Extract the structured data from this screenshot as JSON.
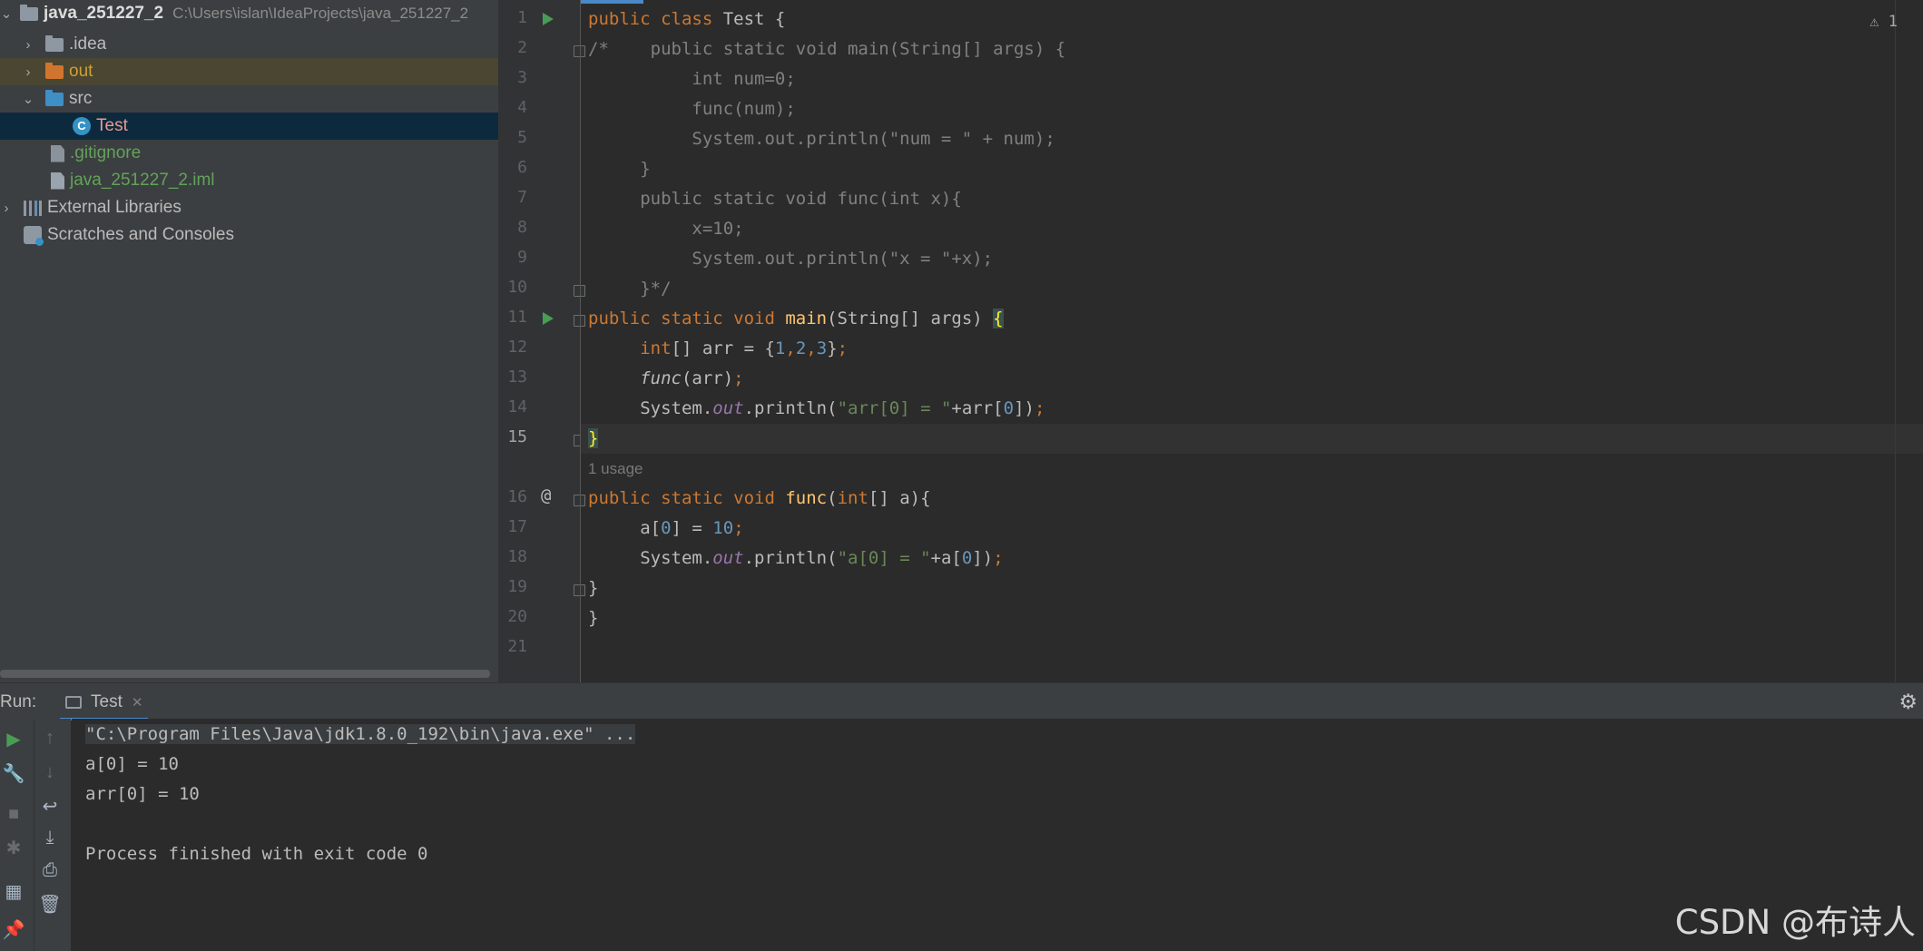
{
  "project_tree": {
    "root_name": "java_251227_2",
    "root_path": "C:\\Users\\islan\\IdeaProjects\\java_251227_2",
    "items": [
      {
        "label": ".idea"
      },
      {
        "label": "out"
      },
      {
        "label": "src"
      },
      {
        "label": "Test"
      },
      {
        "label": ".gitignore"
      },
      {
        "label": "java_251227_2.iml"
      },
      {
        "label": "External Libraries"
      },
      {
        "label": "Scratches and Consoles"
      }
    ]
  },
  "editor": {
    "warning_count": "1",
    "usage_hint": "1 usage",
    "line_numbers": [
      "1",
      "2",
      "3",
      "4",
      "5",
      "6",
      "7",
      "8",
      "9",
      "10",
      "11",
      "12",
      "13",
      "14",
      "15",
      "16",
      "17",
      "18",
      "19",
      "20",
      "21"
    ],
    "current_line": "15"
  },
  "run_panel": {
    "title": "Run:",
    "tab_label": "Test",
    "console_lines": [
      "\"C:\\Program Files\\Java\\jdk1.8.0_192\\bin\\java.exe\" ...",
      "a[0] = 10",
      "arr[0] = 10",
      "",
      "Process finished with exit code 0"
    ]
  },
  "watermark": "CSDN @布诗人",
  "colors": {
    "keyword": "#cc7832",
    "function": "#ffc66d",
    "number": "#6897bb",
    "string": "#6a8759",
    "comment": "#808080",
    "static_field": "#9876aa",
    "selection": "#0d293e",
    "run_green": "#499c54"
  }
}
